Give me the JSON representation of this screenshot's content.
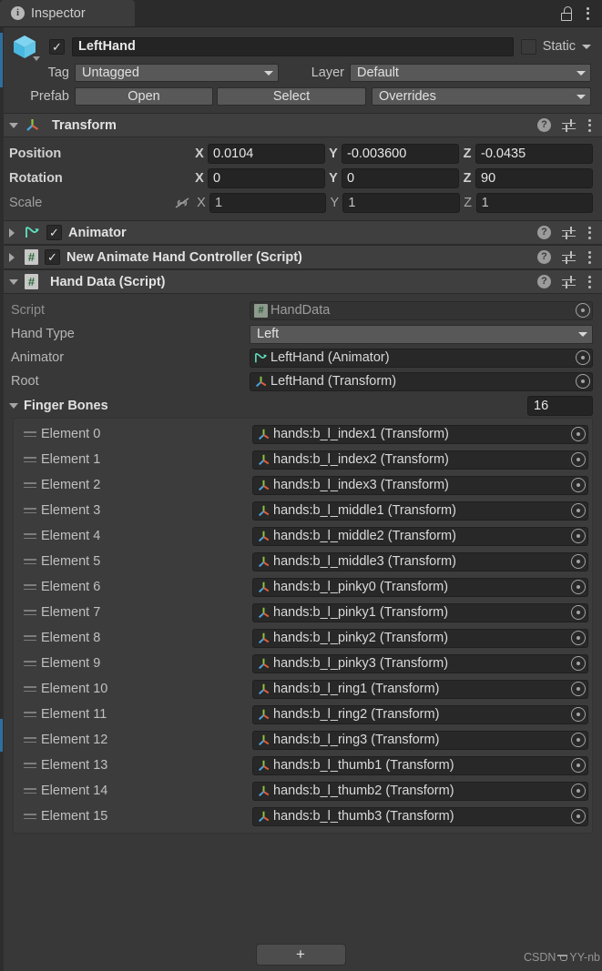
{
  "tab": {
    "label": "Inspector",
    "info_icon": "info-icon",
    "lock_icon": "lock-open-icon",
    "menu_icon": "kebab-menu-icon"
  },
  "gameobject": {
    "icon": "prefab-cube-icon",
    "enabled": true,
    "enabled_check": "✓",
    "name": "LeftHand",
    "static_label": "Static",
    "static_checked": false,
    "tag_label": "Tag",
    "tag_value": "Untagged",
    "layer_label": "Layer",
    "layer_value": "Default",
    "prefab_label": "Prefab",
    "prefab_open": "Open",
    "prefab_select": "Select",
    "prefab_overrides": "Overrides"
  },
  "transform": {
    "title": "Transform",
    "icon": "transform-axis-icon",
    "expanded": true,
    "help_icon": "?",
    "rows": [
      {
        "label": "Position",
        "x": "0.0104",
        "y": "-0.003600",
        "z": "-0.0435",
        "dim": false,
        "link": false
      },
      {
        "label": "Rotation",
        "x": "0",
        "y": "0",
        "z": "90",
        "dim": false,
        "link": false
      },
      {
        "label": "Scale",
        "x": "1",
        "y": "1",
        "z": "1",
        "dim": true,
        "link": true
      }
    ],
    "axis_x": "X",
    "axis_y": "Y",
    "axis_z": "Z"
  },
  "animator": {
    "title": "Animator",
    "icon": "animator-icon",
    "enabled": true,
    "enabled_check": "✓",
    "expanded": false
  },
  "hand_controller": {
    "title": "New Animate Hand Controller (Script)",
    "icon": "csharp-script-icon",
    "enabled": true,
    "enabled_check": "✓",
    "expanded": false
  },
  "hand_data": {
    "title": "Hand Data (Script)",
    "icon": "csharp-script-icon",
    "expanded": true,
    "fields": [
      {
        "label": "Script",
        "value": "HandData",
        "type": "object-readonly",
        "icon": "csharp-script-icon"
      },
      {
        "label": "Hand Type",
        "value": "Left",
        "type": "dropdown",
        "icon": ""
      },
      {
        "label": "Animator",
        "value": "LeftHand (Animator)",
        "type": "object",
        "icon": "animator-icon"
      },
      {
        "label": "Root",
        "value": "LeftHand (Transform)",
        "type": "object",
        "icon": "transform-axis-icon"
      }
    ],
    "finger_bones": {
      "label": "Finger Bones",
      "expanded": true,
      "size": "16",
      "elements": [
        {
          "label": "Element 0",
          "value": "hands:b_l_index1 (Transform)"
        },
        {
          "label": "Element 1",
          "value": "hands:b_l_index2 (Transform)"
        },
        {
          "label": "Element 2",
          "value": "hands:b_l_index3 (Transform)"
        },
        {
          "label": "Element 3",
          "value": "hands:b_l_middle1 (Transform)"
        },
        {
          "label": "Element 4",
          "value": "hands:b_l_middle2 (Transform)"
        },
        {
          "label": "Element 5",
          "value": "hands:b_l_middle3 (Transform)"
        },
        {
          "label": "Element 6",
          "value": "hands:b_l_pinky0 (Transform)"
        },
        {
          "label": "Element 7",
          "value": "hands:b_l_pinky1 (Transform)"
        },
        {
          "label": "Element 8",
          "value": "hands:b_l_pinky2 (Transform)"
        },
        {
          "label": "Element 9",
          "value": "hands:b_l_pinky3 (Transform)"
        },
        {
          "label": "Element 10",
          "value": "hands:b_l_ring1 (Transform)"
        },
        {
          "label": "Element 11",
          "value": "hands:b_l_ring2 (Transform)"
        },
        {
          "label": "Element 12",
          "value": "hands:b_l_ring3 (Transform)"
        },
        {
          "label": "Element 13",
          "value": "hands:b_l_thumb1 (Transform)"
        },
        {
          "label": "Element 14",
          "value": "hands:b_l_thumb2 (Transform)"
        },
        {
          "label": "Element 15",
          "value": "hands:b_l_thumb3 (Transform)"
        }
      ]
    }
  },
  "footer": {
    "add_component_label": "+",
    "watermark_prefix": "CSDN",
    "watermark_suffix": "YY-nb"
  },
  "colors": {
    "background": "#383838",
    "header": "#3f3f3f",
    "field": "#242424",
    "dropdown": "#585858",
    "accent_blue": "#4fc3e8",
    "text": "#d9d9d9"
  }
}
